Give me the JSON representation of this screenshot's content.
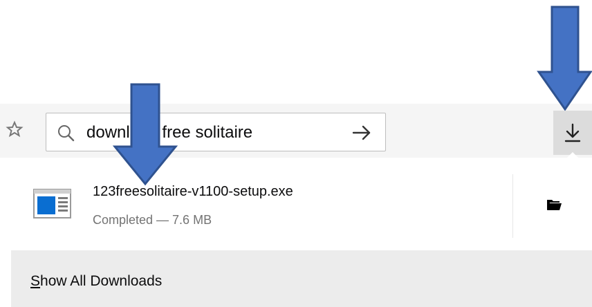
{
  "toolbar": {
    "search_value": "download free solitaire",
    "search_icon": "search-icon",
    "go_icon": "arrow-right-icon",
    "bookmark_icon": "star-icon",
    "download_icon": "download-arrow-icon"
  },
  "downloads_panel": {
    "items": [
      {
        "file_name": "123freesolitaire-v1100-setup.exe",
        "status": "Completed — 7.6 MB",
        "file_icon": "executable-file-icon",
        "action_icon": "folder-icon"
      }
    ],
    "show_all_prefix": "S",
    "show_all_rest": "how All Downloads"
  },
  "colors": {
    "annotation_arrow_fill": "#4472c4",
    "annotation_arrow_stroke": "#2f528f",
    "file_icon_blue": "#0a6ed1"
  }
}
